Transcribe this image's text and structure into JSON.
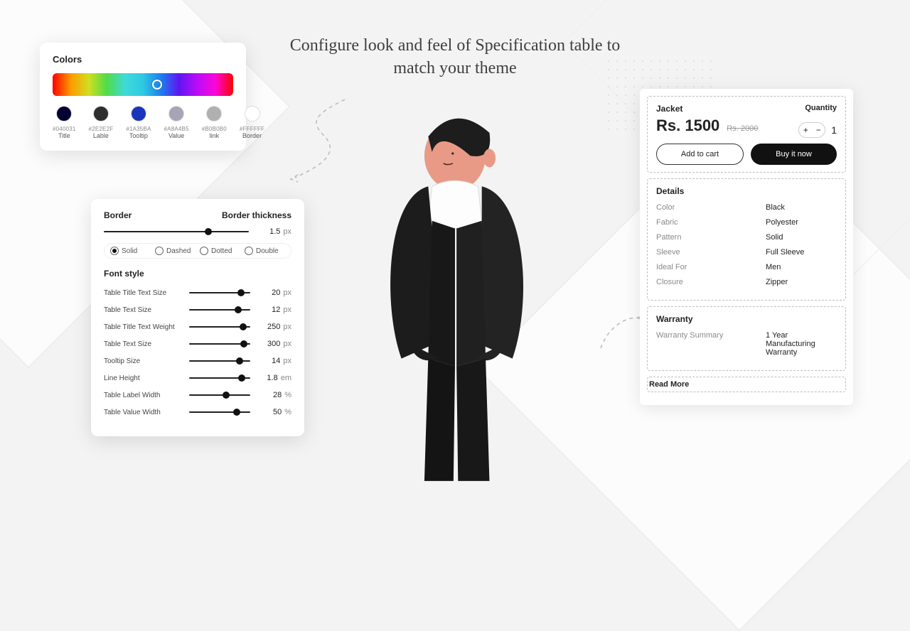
{
  "headline": "Configure look and feel of Specification table to match your theme",
  "colors_panel": {
    "title": "Colors",
    "swatches": [
      {
        "hex": "#040031",
        "name": "Title"
      },
      {
        "hex": "#2E2E2F",
        "name": "Lable"
      },
      {
        "hex": "#1A35BA",
        "name": "Tooltip"
      },
      {
        "hex": "#A8A4B5",
        "name": "Value"
      },
      {
        "hex": "#B0B0B0",
        "name": "link"
      },
      {
        "hex": "#FFFFFF",
        "name": "Border"
      }
    ]
  },
  "border_panel": {
    "border_label": "Border",
    "thickness_label": "Border thickness",
    "thickness": {
      "value": "1.5",
      "unit": "px",
      "pct": 72
    },
    "styles": [
      "Solid",
      "Dashed",
      "Dotted",
      "Double"
    ],
    "selected_style": "Solid",
    "font_title": "Font style",
    "fonts": [
      {
        "label": "Table Title Text Size",
        "value": "20",
        "unit": "px",
        "pct": 85
      },
      {
        "label": "Table Text Size",
        "value": "12",
        "unit": "px",
        "pct": 80
      },
      {
        "label": "Table Title Text Weight",
        "value": "250",
        "unit": "px",
        "pct": 88
      },
      {
        "label": "Table Text Size",
        "value": "300",
        "unit": "px",
        "pct": 90
      },
      {
        "label": "Tooltip Size",
        "value": "14",
        "unit": "px",
        "pct": 82
      },
      {
        "label": "Line Height",
        "value": "1.8",
        "unit": "em",
        "pct": 86
      },
      {
        "label": "Table Label Width",
        "value": "28",
        "unit": "%",
        "pct": 60
      },
      {
        "label": "Table Value Width",
        "value": "50",
        "unit": "%",
        "pct": 78
      }
    ]
  },
  "product": {
    "name": "Jacket",
    "quantity_label": "Quantity",
    "price": "Rs. 1500",
    "old_price": "Rs. 2000",
    "quantity": "1",
    "add_to_cart": "Add to cart",
    "buy_now": "Buy it now",
    "details_title": "Details",
    "details": [
      {
        "k": "Color",
        "v": "Black"
      },
      {
        "k": "Fabric",
        "v": "Polyester"
      },
      {
        "k": "Pattern",
        "v": "Solid"
      },
      {
        "k": "Sleeve",
        "v": "Full Sleeve"
      },
      {
        "k": "Ideal For",
        "v": "Men"
      },
      {
        "k": "Closure",
        "v": "Zipper"
      }
    ],
    "warranty_title": "Warranty",
    "warranty": [
      {
        "k": "Warranty Summary",
        "v": "1 Year Manufacturing Warranty"
      }
    ],
    "read_more": "Read More"
  }
}
